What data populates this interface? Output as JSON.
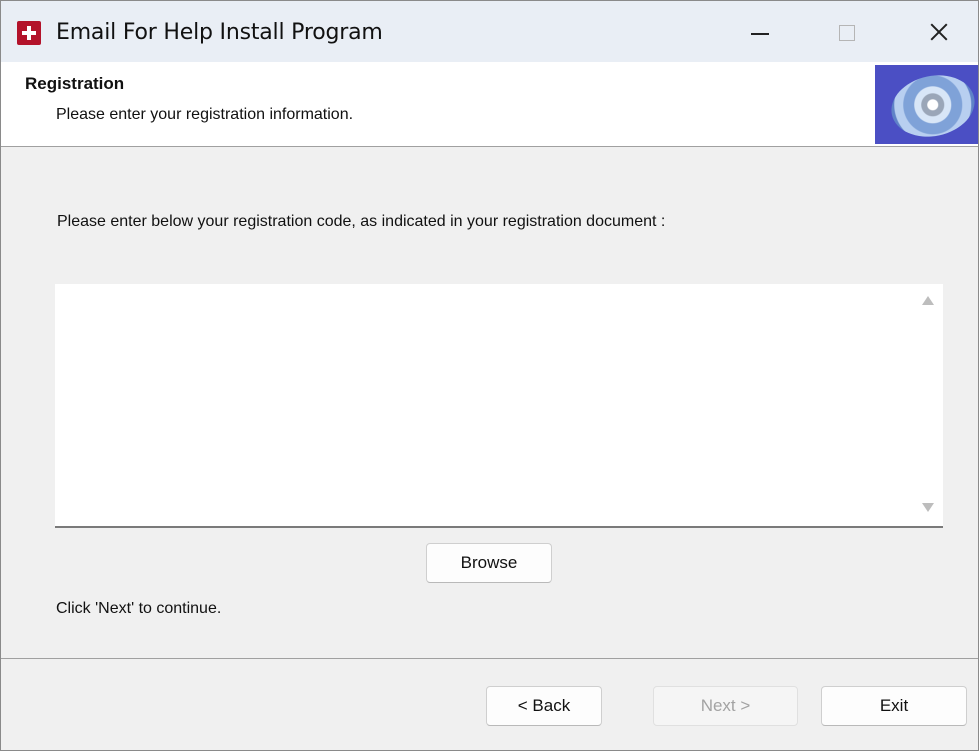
{
  "window": {
    "title": "Email For Help Install Program"
  },
  "header": {
    "title": "Registration",
    "subtitle": "Please enter your registration information."
  },
  "main": {
    "instruction": "Please enter below your registration code, as indicated in your registration document :",
    "registration_code_value": "",
    "browse_label": "Browse",
    "continue_text": "Click 'Next' to continue."
  },
  "footer": {
    "back_label": "< Back",
    "next_label": "Next >",
    "exit_label": "Exit"
  },
  "icons": {
    "app": "installer-app-icon",
    "header": "cd-disc-icon",
    "minimize": "minimize-icon",
    "maximize": "maximize-icon",
    "close": "close-icon",
    "scroll_up": "scroll-up-arrow-icon",
    "scroll_down": "scroll-down-arrow-icon"
  },
  "colors": {
    "header_image_bg": "#4b4fc4",
    "app_icon": "#b3122a",
    "disabled_text": "#a3a3a3"
  },
  "state": {
    "next_enabled": false,
    "maximize_enabled": false
  }
}
